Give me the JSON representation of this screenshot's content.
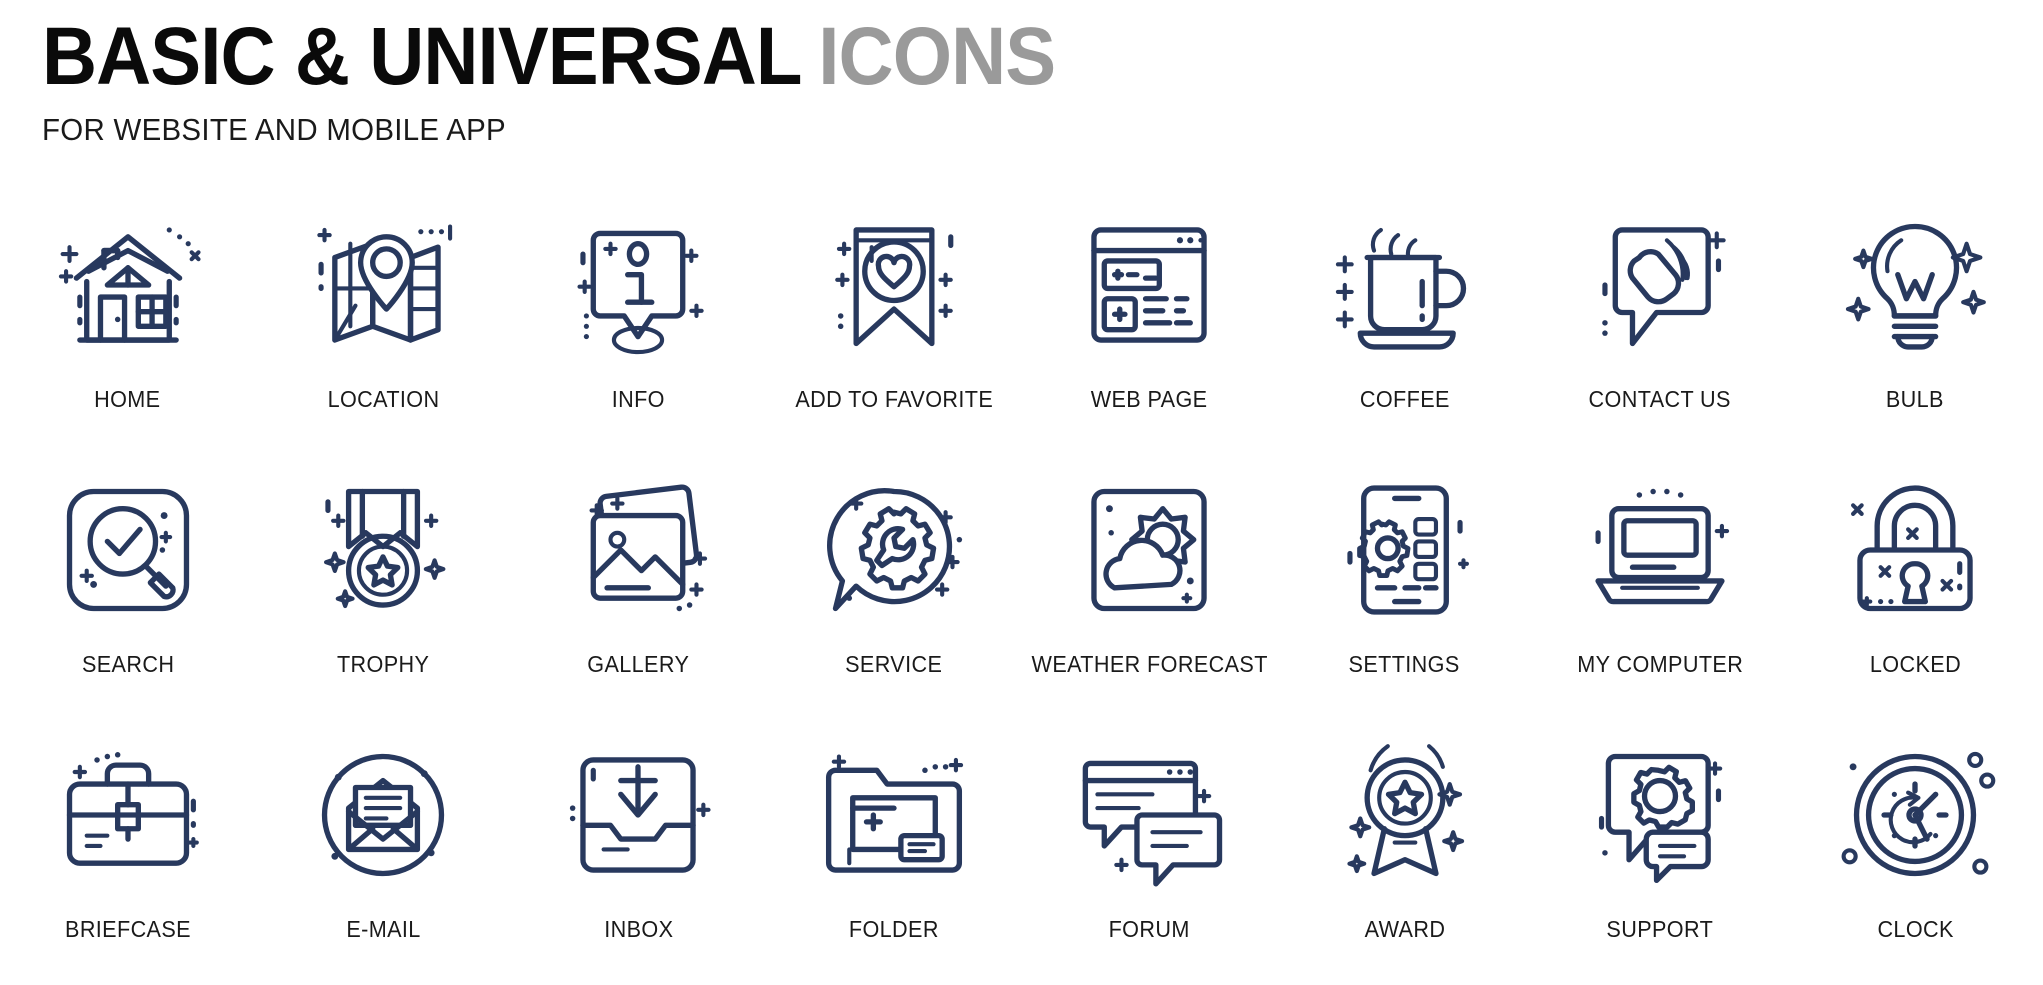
{
  "header": {
    "title_main": "BASIC & UNIVERSAL",
    "title_accent": "ICONS",
    "subtitle": "FOR WEBSITE AND MOBILE APP"
  },
  "colors": {
    "icon_stroke": "#28395e",
    "title_main": "#0a0a0a",
    "title_accent": "#9a9a9a",
    "label": "#1a1a1a",
    "background": "#ffffff"
  },
  "grid": {
    "columns": 8,
    "rows": 3
  },
  "icons": [
    {
      "label": "HOME",
      "icon": "home-icon"
    },
    {
      "label": "LOCATION",
      "icon": "location-map-pin-icon"
    },
    {
      "label": "INFO",
      "icon": "info-speech-bubble-icon"
    },
    {
      "label": "ADD TO FAVORITE",
      "icon": "bookmark-heart-icon"
    },
    {
      "label": "WEB PAGE",
      "icon": "browser-window-icon"
    },
    {
      "label": "COFFEE",
      "icon": "coffee-cup-icon"
    },
    {
      "label": "CONTACT US",
      "icon": "phone-receiver-bubble-icon"
    },
    {
      "label": "BULB",
      "icon": "light-bulb-icon"
    },
    {
      "label": "SEARCH",
      "icon": "magnifier-check-icon"
    },
    {
      "label": "TROPHY",
      "icon": "medal-ribbon-icon"
    },
    {
      "label": "GALLERY",
      "icon": "photo-stack-icon"
    },
    {
      "label": "SERVICE",
      "icon": "gear-wrench-bubble-icon"
    },
    {
      "label": "WEATHER FORECAST",
      "icon": "sun-cloud-icon"
    },
    {
      "label": "SETTINGS",
      "icon": "phone-gear-icon"
    },
    {
      "label": "MY COMPUTER",
      "icon": "laptop-icon"
    },
    {
      "label": "LOCKED",
      "icon": "padlock-icon"
    },
    {
      "label": "BRIEFCASE",
      "icon": "briefcase-icon"
    },
    {
      "label": "E-MAIL",
      "icon": "open-envelope-icon"
    },
    {
      "label": "INBOX",
      "icon": "inbox-download-icon"
    },
    {
      "label": "FOLDER",
      "icon": "folder-icon"
    },
    {
      "label": "FORUM",
      "icon": "forum-chat-icon"
    },
    {
      "label": "AWARD",
      "icon": "award-badge-icon"
    },
    {
      "label": "SUPPORT",
      "icon": "support-gear-bubble-icon"
    },
    {
      "label": "CLOCK",
      "icon": "clock-icon"
    }
  ]
}
